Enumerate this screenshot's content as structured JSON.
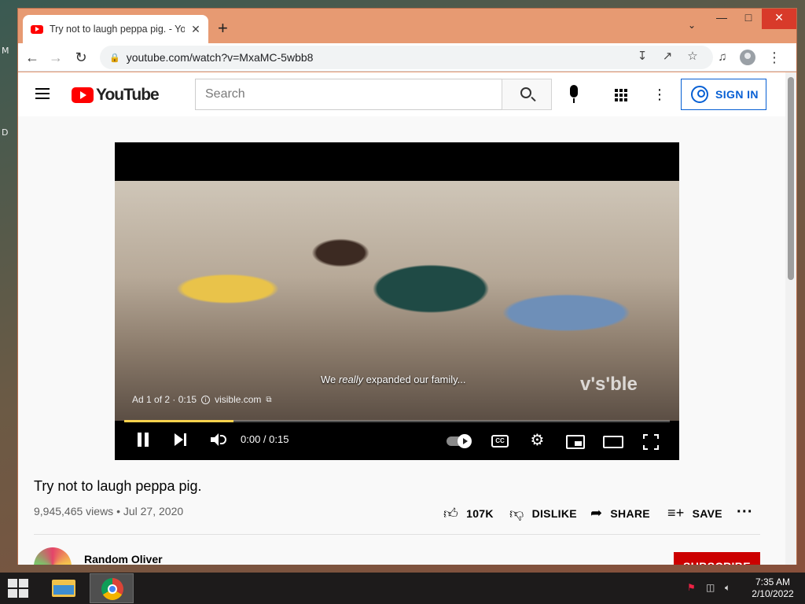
{
  "desktop": {
    "frag_top": "M",
    "frag_mid": "D"
  },
  "browser": {
    "tab_title": "Try not to laugh peppa pig. - You",
    "tab_close": "✕",
    "new_tab": "+",
    "tab_search": "⌄",
    "win_min": "—",
    "win_max": "□",
    "win_close": "✕",
    "url": "youtube.com/watch?v=MxaMC-5wbb8",
    "lock": "🔒"
  },
  "youtube": {
    "logo_text": "YouTube",
    "search_placeholder": "Search",
    "sign_in": "SIGN IN",
    "more": "⋮"
  },
  "player": {
    "caption_pre": "We ",
    "caption_em": "really",
    "caption_post": " expanded our family...",
    "watermark": "v's'ble",
    "ad_label": "Ad 1 of 2 · 0:15",
    "ad_info": "i",
    "ad_site": "visible.com",
    "ad_ext": "⧉",
    "time": "0:00 / 0:15",
    "cc": "CC",
    "gear": "⚙",
    "progress": 0.2
  },
  "video": {
    "title": "Try not to laugh peppa pig.",
    "stats": "9,945,465 views • Jul 27, 2020",
    "like_count": "107K",
    "dislike": "DISLIKE",
    "share": "SHARE",
    "save": "SAVE",
    "more": "···",
    "channel": "Random Oliver",
    "subscribe": "SUBSCRIBE"
  },
  "taskbar": {
    "time": "7:35 AM",
    "date": "2/10/2022"
  },
  "colors": {
    "window_frame": "#e79a72",
    "youtube_red": "#ff0000",
    "link_blue": "#065fd4",
    "subscribe_red": "#cc0000"
  }
}
